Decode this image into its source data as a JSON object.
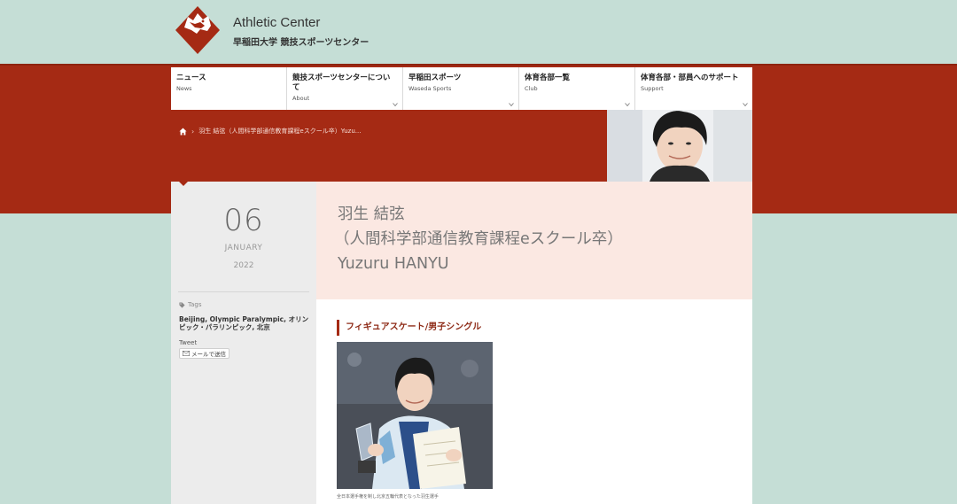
{
  "header": {
    "site_title": "Athletic Center",
    "site_subtitle": "早稲田大学 競技スポーツセンター"
  },
  "nav": {
    "items": [
      {
        "jp": "ニュース",
        "en": "News"
      },
      {
        "jp": "競技スポーツセンターについて",
        "en": "About"
      },
      {
        "jp": "早稲田スポーツ",
        "en": "Waseda Sports"
      },
      {
        "jp": "体育各部一覧",
        "en": "Club"
      },
      {
        "jp": "体育各部・部員へのサポート",
        "en": "Support"
      }
    ]
  },
  "breadcrumb": {
    "current": "羽生 結弦（人間科学部通信教育課程eスクール卒）Yuzu..."
  },
  "date": {
    "day": "06",
    "month": "JANUARY",
    "year": "2022"
  },
  "tags": {
    "label": "Tags",
    "list": "Beijing, Olympic Paralympic, オリンピック・パラリンピック, 北京"
  },
  "share": {
    "tweet_label": "Tweet",
    "mail_label": "メールで送信"
  },
  "article": {
    "title_line1": "羽生 結弦",
    "title_line2": "（人間科学部通信教育課程eスクール卒）",
    "title_line3": "Yuzuru HANYU",
    "section_heading": "フィギュアスケート/男子シングル",
    "photo_caption": "全日本選手権を制し北京五輪代表となった羽生選手"
  },
  "colors": {
    "accent": "#a52a14",
    "background": "#c5ded6",
    "title_bg": "#fbe8e2"
  },
  "icons": [
    "bear-logo-icon",
    "home-icon",
    "chevron-down-icon",
    "tag-icon",
    "mail-icon"
  ]
}
